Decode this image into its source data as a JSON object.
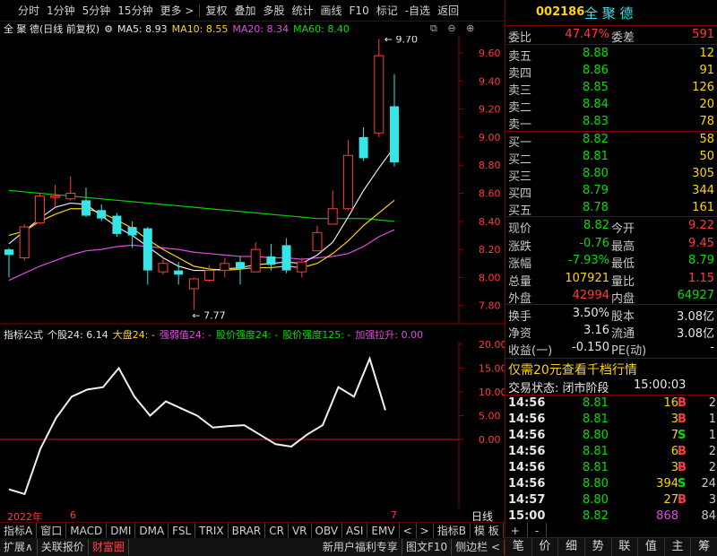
{
  "toolbar": {
    "items": [
      "分时",
      "1分钟",
      "5分钟",
      "15分钟",
      "更多 >",
      "复权",
      "叠加",
      "多股",
      "统计",
      "画线",
      "F10",
      "标记",
      "-自选",
      "返回"
    ]
  },
  "chart_header": {
    "title": "全 聚 德(日线 前复权)",
    "ma5": "MA5: 8.93",
    "ma10": "MA10: 8.55",
    "ma20": "MA20: 8.34",
    "ma60": "MA60: 8.40"
  },
  "price_axis": [
    "9.60",
    "9.40",
    "9.20",
    "9.00",
    "8.80",
    "8.60",
    "8.40",
    "8.20",
    "8.00",
    "7.80"
  ],
  "high_label": "9.70",
  "low_label": "7.77",
  "indicator_header": {
    "name": "指标公式",
    "v1": "个股24: 6.14",
    "v2": "大盘24: -",
    "v3": "强弱值24: -",
    "v4": "股价强度24: -",
    "v5": "股价强度125: -",
    "v6": "加强拉升: 0.00"
  },
  "indicator_axis": [
    "20.00",
    "15.00",
    "10.00",
    "5.00",
    "0.00"
  ],
  "date_axis": {
    "year": "2022年",
    "m6": "6",
    "m7": "7",
    "period": "日线"
  },
  "tabs": [
    "指标A",
    "窗口",
    "MACD",
    "DMI",
    "DMA",
    "FSL",
    "TRIX",
    "BRAR",
    "CR",
    "VR",
    "OBV",
    "ASI",
    "EMV"
  ],
  "tab_nav": [
    "<",
    ">"
  ],
  "tabs_right": [
    "指标B",
    "模 板",
    "+",
    "-"
  ],
  "bottom_left": [
    "扩展∧",
    "关联报价",
    "财富圈"
  ],
  "bottom_right": [
    "新用户福利专享",
    "图文F10",
    "侧边栏 <"
  ],
  "stock": {
    "code": "002186",
    "name": "全 聚 德"
  },
  "order_book": {
    "wb_label": "委比",
    "wb": "47.47%",
    "wc_label": "委差",
    "wc": "591",
    "asks": [
      {
        "label": "卖五",
        "price": "8.88",
        "vol": "12"
      },
      {
        "label": "卖四",
        "price": "8.86",
        "vol": "91"
      },
      {
        "label": "卖三",
        "price": "8.85",
        "vol": "126"
      },
      {
        "label": "卖二",
        "price": "8.84",
        "vol": "20"
      },
      {
        "label": "卖一",
        "price": "8.83",
        "vol": "78"
      }
    ],
    "bids": [
      {
        "label": "买一",
        "price": "8.82",
        "vol": "58"
      },
      {
        "label": "买二",
        "price": "8.81",
        "vol": "50"
      },
      {
        "label": "买三",
        "price": "8.80",
        "vol": "305"
      },
      {
        "label": "买四",
        "price": "8.79",
        "vol": "344"
      },
      {
        "label": "买五",
        "price": "8.78",
        "vol": "161"
      }
    ]
  },
  "quote": [
    {
      "l1": "现价",
      "v1": "8.82",
      "c1": "green",
      "l2": "今开",
      "v2": "9.22",
      "c2": "red"
    },
    {
      "l1": "涨跌",
      "v1": "-0.76",
      "c1": "green",
      "l2": "最高",
      "v2": "9.45",
      "c2": "red"
    },
    {
      "l1": "涨幅",
      "v1": "-7.93%",
      "c1": "green",
      "l2": "最低",
      "v2": "8.79",
      "c2": "green"
    },
    {
      "l1": "总量",
      "v1": "107921",
      "c1": "yellow",
      "l2": "量比",
      "v2": "1.15",
      "c2": "red"
    },
    {
      "l1": "外盘",
      "v1": "42994",
      "c1": "red",
      "l2": "内盘",
      "v2": "64927",
      "c2": "green"
    }
  ],
  "fund": [
    {
      "l1": "换手",
      "v1": "3.50%",
      "l2": "股本",
      "v2": "3.08亿"
    },
    {
      "l1": "净资",
      "v1": "3.16",
      "l2": "流通",
      "v2": "3.08亿"
    },
    {
      "l1": "收益(一)",
      "v1": "-0.150",
      "l2": "PE(动)",
      "v2": "-"
    }
  ],
  "promo": "仅需20元查看千档行情",
  "trade_status": {
    "label": "交易状态: 闭市阶段",
    "time": "15:00:03"
  },
  "ticks": [
    {
      "t": "14:56",
      "p": "8.81",
      "v": "16",
      "s": "B",
      "n": "2",
      "vc": "yellow",
      "sc": "red"
    },
    {
      "t": "14:56",
      "p": "8.81",
      "v": "3",
      "s": "B",
      "n": "1",
      "vc": "yellow",
      "sc": "red"
    },
    {
      "t": "14:56",
      "p": "8.80",
      "v": "7",
      "s": "S",
      "n": "1",
      "vc": "yellow",
      "sc": "green"
    },
    {
      "t": "14:56",
      "p": "8.81",
      "v": "6",
      "s": "B",
      "n": "2",
      "vc": "yellow",
      "sc": "red"
    },
    {
      "t": "14:56",
      "p": "8.81",
      "v": "3",
      "s": "B",
      "n": "2",
      "vc": "yellow",
      "sc": "red"
    },
    {
      "t": "14:56",
      "p": "8.80",
      "v": "394",
      "s": "S",
      "n": "24",
      "vc": "yellow",
      "sc": "green"
    },
    {
      "t": "14:57",
      "p": "8.80",
      "v": "27",
      "s": "B",
      "n": "3",
      "vc": "yellow",
      "sc": "red"
    },
    {
      "t": "15:00",
      "p": "8.82",
      "v": "868",
      "s": "",
      "n": "84",
      "vc": "mag",
      "sc": "red"
    }
  ],
  "right_tabs": [
    "笔",
    "价",
    "细",
    "势",
    "联",
    "值",
    "主",
    "筹"
  ],
  "candles": [
    {
      "o": 8.16,
      "c": 8.2,
      "h": 8.21,
      "l": 8.0,
      "up": false
    },
    {
      "o": 8.14,
      "c": 8.36,
      "h": 8.38,
      "l": 8.12,
      "up": true
    },
    {
      "o": 8.39,
      "c": 8.58,
      "h": 8.6,
      "l": 8.38,
      "up": true
    },
    {
      "o": 8.58,
      "c": 8.57,
      "h": 8.66,
      "l": 8.5,
      "up": true
    },
    {
      "o": 8.56,
      "c": 8.6,
      "h": 8.72,
      "l": 8.55,
      "up": true
    },
    {
      "o": 8.55,
      "c": 8.44,
      "h": 8.64,
      "l": 8.43,
      "up": false
    },
    {
      "o": 8.48,
      "c": 8.42,
      "h": 8.52,
      "l": 8.4,
      "up": false
    },
    {
      "o": 8.44,
      "c": 8.31,
      "h": 8.46,
      "l": 8.29,
      "up": false
    },
    {
      "o": 8.36,
      "c": 8.3,
      "h": 8.4,
      "l": 8.21,
      "up": false
    },
    {
      "o": 8.35,
      "c": 8.05,
      "h": 8.36,
      "l": 7.95,
      "up": false
    },
    {
      "o": 8.04,
      "c": 8.1,
      "h": 8.14,
      "l": 8.02,
      "up": true
    },
    {
      "o": 8.05,
      "c": 8.02,
      "h": 8.11,
      "l": 7.95,
      "up": false
    },
    {
      "o": 7.92,
      "c": 7.99,
      "h": 8.0,
      "l": 7.77,
      "up": true
    },
    {
      "o": 7.98,
      "c": 8.05,
      "h": 8.09,
      "l": 7.97,
      "up": true
    },
    {
      "o": 8.05,
      "c": 8.1,
      "h": 8.14,
      "l": 8.0,
      "up": true
    },
    {
      "o": 8.11,
      "c": 8.06,
      "h": 8.15,
      "l": 7.95,
      "up": false
    },
    {
      "o": 8.04,
      "c": 8.2,
      "h": 8.25,
      "l": 8.04,
      "up": true
    },
    {
      "o": 8.15,
      "c": 8.09,
      "h": 8.24,
      "l": 8.05,
      "up": false
    },
    {
      "o": 8.23,
      "c": 8.05,
      "h": 8.28,
      "l": 8.03,
      "up": false
    },
    {
      "o": 8.04,
      "c": 8.11,
      "h": 8.14,
      "l": 8.0,
      "up": true
    },
    {
      "o": 8.19,
      "c": 8.32,
      "h": 8.37,
      "l": 8.19,
      "up": true
    },
    {
      "o": 8.38,
      "c": 8.49,
      "h": 8.62,
      "l": 8.38,
      "up": true
    },
    {
      "o": 8.49,
      "c": 8.87,
      "h": 8.98,
      "l": 8.48,
      "up": true
    },
    {
      "o": 8.85,
      "c": 9.0,
      "h": 9.07,
      "l": 8.83,
      "up": false
    },
    {
      "o": 9.03,
      "c": 9.58,
      "h": 9.7,
      "l": 9.0,
      "up": true
    },
    {
      "o": 9.22,
      "c": 8.82,
      "h": 9.45,
      "l": 8.79,
      "up": false
    }
  ],
  "ind_values": [
    -10.5,
    -11.5,
    -2,
    4.5,
    9,
    10.5,
    11,
    15,
    9,
    5,
    8,
    6.5,
    5,
    2.5,
    2.8,
    3,
    1,
    -1,
    -1.5,
    1,
    3,
    11,
    9,
    17,
    6.14
  ]
}
